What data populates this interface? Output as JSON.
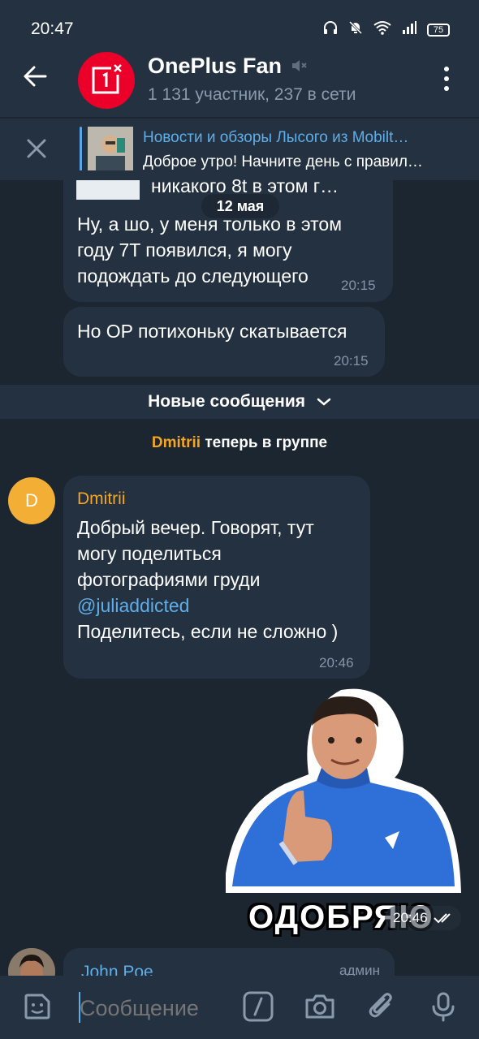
{
  "status_bar": {
    "time": "20:47",
    "battery": "75",
    "icons": [
      "headphones-icon",
      "bell-off-icon",
      "wifi-icon",
      "signal-icon",
      "battery-icon"
    ]
  },
  "header": {
    "title": "OnePlus Fan",
    "subtitle": "1 131 участник, 237 в сети",
    "muted": true,
    "avatar_color": "#eb0029",
    "avatar_glyph": "1"
  },
  "pinned": {
    "title": "Новости и обзоры Лысого из Mobilt…",
    "text": "Доброе утро! Начните день с правил…"
  },
  "messages": {
    "partial_reply_text": "никакого 8t в этом г…",
    "date_chip": "12 мая",
    "m1": {
      "lines": [
        "Ну, а шо, у меня только в этом",
        "году 7T появился, я могу",
        "подождать до следующего"
      ],
      "time": "20:15"
    },
    "m2": {
      "text": "Но OP потихоньку скатывается",
      "time": "20:15"
    },
    "new_messages_label": "Новые сообщения",
    "service": {
      "name": "Dmitrii",
      "text": " теперь в группе"
    },
    "m3": {
      "avatar_letter": "D",
      "sender": "Dmitrii",
      "lines": [
        "Добрый вечер. Говорят, тут",
        "могу поделиться",
        "фотографиями груди"
      ],
      "mention": "@juliaddicted",
      "last_line": "Поделитесь, если не сложно )",
      "time": "20:46"
    },
    "sticker": {
      "caption": "ОДОБРЯЮ",
      "time": "20:46"
    },
    "m4": {
      "sender": "John Poe",
      "badge": "админ"
    }
  },
  "input": {
    "placeholder": "Сообщение"
  },
  "colors": {
    "background": "#1c2631",
    "bar": "#243140",
    "accent": "#5eaee9",
    "sender_orange": "#f5a623"
  }
}
